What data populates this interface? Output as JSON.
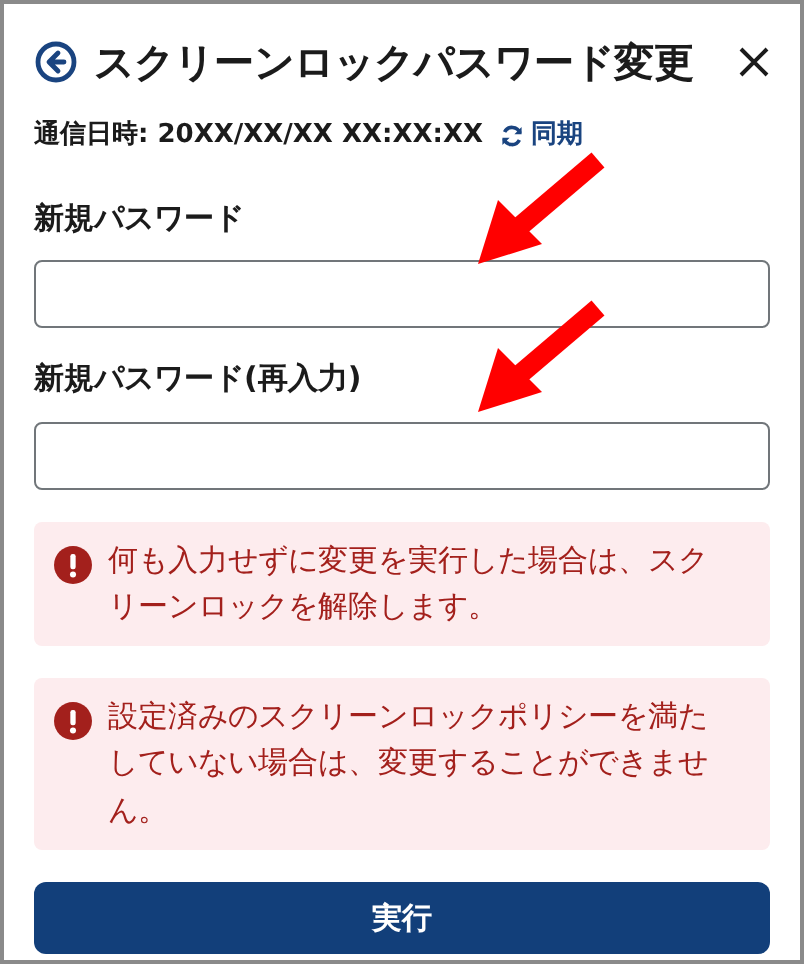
{
  "header": {
    "title": "スクリーンロックパスワード変更"
  },
  "sync": {
    "label": "通信日時:",
    "value": "20XX/XX/XX XX:XX:XX",
    "link": "同期"
  },
  "fields": [
    {
      "label": "新規パスワード"
    },
    {
      "label": "新規パスワード(再入力)"
    }
  ],
  "alerts": [
    {
      "text": "何も入力せずに変更を実行した場合は、スクリーンロックを解除します。"
    },
    {
      "text": "設定済みのスクリーンロックポリシーを満たしていない場合は、変更することができません。"
    }
  ],
  "button": "実行"
}
